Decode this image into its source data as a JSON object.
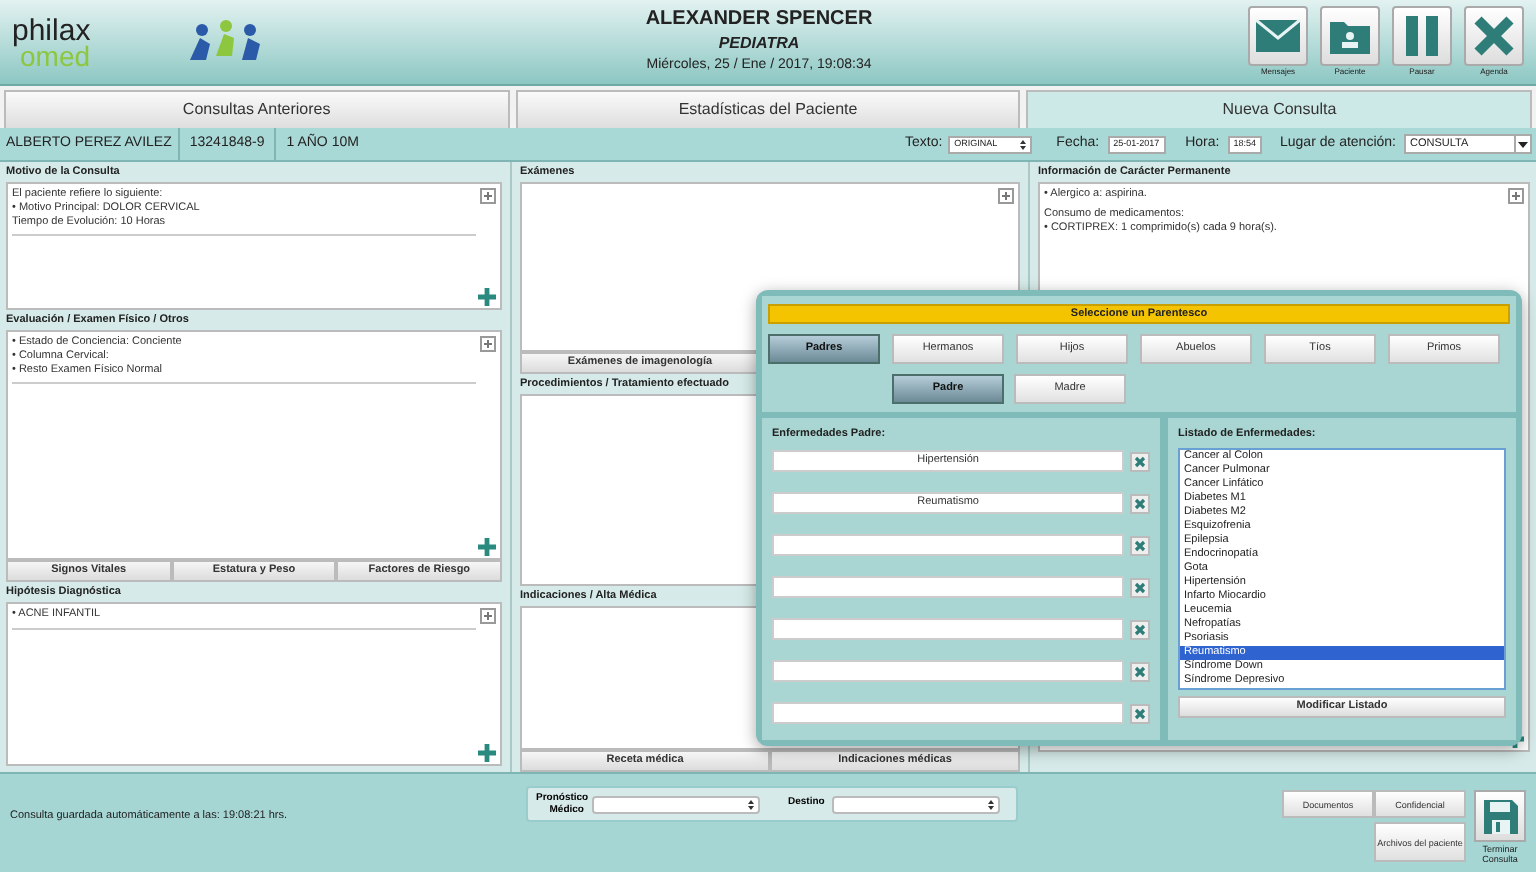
{
  "header": {
    "logo": {
      "word_1": "philax",
      "word_2": "omed"
    },
    "patient_name": "ALEXANDER SPENCER",
    "specialty": "PEDIATRA",
    "datetime": "Miércoles, 25 / Ene / 2017, 19:08:34",
    "actions": [
      {
        "kind": "mail",
        "label": "Mensajes"
      },
      {
        "kind": "folder",
        "label": "Paciente"
      },
      {
        "kind": "pause",
        "label": "Pausar"
      },
      {
        "kind": "close",
        "label": "Agenda"
      }
    ]
  },
  "tabs": [
    {
      "label": "Consultas Anteriores",
      "selected": false
    },
    {
      "label": "Estadísticas del Paciente",
      "selected": false
    },
    {
      "label": "Nueva Consulta",
      "selected": true
    }
  ],
  "patient_bar": {
    "name": "ALBERTO PEREZ AVILEZ",
    "id": "13241848-9",
    "age": "1 AÑO 10M",
    "texto_label": "Texto:",
    "texto_value": "ORIGINAL",
    "fecha_label": "Fecha:",
    "fecha_value": "25-01-2017",
    "hora_label": "Hora:",
    "hora_value": "18:54",
    "lugar_label": "Lugar de atención:",
    "lugar_value": "CONSULTA"
  },
  "left_column": [
    {
      "title": "Motivo de la Consulta",
      "lines": [
        "El paciente refiere lo siguiente:",
        "• Motivo Principal: DOLOR CERVICAL",
        "Tiempo de Evolución: 10 Horas"
      ]
    },
    {
      "title": "Evaluación / Examen Físico / Otros",
      "lines": [
        "• Estado de Conciencia: Conciente",
        "• Columna Cervical:",
        "• Resto Examen Físico Normal"
      ],
      "buttons": [
        "Signos Vitales",
        "Estatura y Peso",
        "Factores de Riesgo"
      ]
    },
    {
      "title": "Hipótesis Diagnóstica",
      "lines": [
        "• ACNE INFANTIL"
      ]
    }
  ],
  "middle_column": [
    {
      "title": "Exámenes",
      "buttons": [
        "Exámenes de imagenología"
      ]
    },
    {
      "title": "Procedimientos / Tratamiento efectuado"
    },
    {
      "title": "Indicaciones / Alta Médica",
      "buttons": [
        "Receta médica",
        "Indicaciones médicas"
      ]
    }
  ],
  "right_column": {
    "title": "Información de Carácter Permanente",
    "lines": [
      "• Alergico a: aspirina.",
      "Consumo de medicamentos:",
      "• CORTIPREX: 1 comprimido(s) cada 9 hora(s)."
    ]
  },
  "modal": {
    "banner": "Seleccione un Parentesco",
    "relatives": [
      {
        "label": "Padres",
        "selected": true
      },
      {
        "label": "Hermanos",
        "selected": false
      },
      {
        "label": "Hijos",
        "selected": false
      },
      {
        "label": "Abuelos",
        "selected": false
      },
      {
        "label": "Tíos",
        "selected": false
      },
      {
        "label": "Primos",
        "selected": false
      }
    ],
    "members": [
      {
        "label": "Padre",
        "selected": true
      },
      {
        "label": "Madre",
        "selected": false
      }
    ],
    "diseases_title": "Enfermedades Padre:",
    "diseases": [
      {
        "kind": "filled",
        "value": "Hipertensión"
      },
      {
        "kind": "filled",
        "value": "Reumatismo"
      },
      {
        "kind": "empty"
      },
      {
        "kind": "empty"
      },
      {
        "kind": "empty"
      },
      {
        "kind": "empty"
      },
      {
        "kind": "empty"
      }
    ],
    "list_title": "Listado de Enfermedades:",
    "list": [
      {
        "label": "Cancer al Colon",
        "selected": false
      },
      {
        "label": "Cancer Pulmonar",
        "selected": false
      },
      {
        "label": "Cancer Linfático",
        "selected": false
      },
      {
        "label": "Diabetes M1",
        "selected": false
      },
      {
        "label": "Diabetes M2",
        "selected": false
      },
      {
        "label": "Esquizofrenia",
        "selected": false
      },
      {
        "label": "Epilepsia",
        "selected": false
      },
      {
        "label": "Endocrinopatía",
        "selected": false
      },
      {
        "label": "Gota",
        "selected": false
      },
      {
        "label": "Hipertensión",
        "selected": false
      },
      {
        "label": "Infarto Miocardio",
        "selected": false
      },
      {
        "label": "Leucemia",
        "selected": false
      },
      {
        "label": "Nefropatías",
        "selected": false
      },
      {
        "label": "Psoriasis",
        "selected": false
      },
      {
        "label": "Reumatismo",
        "selected": true
      },
      {
        "label": "Síndrome Down",
        "selected": false
      },
      {
        "label": "Síndrome Depresivo",
        "selected": false
      }
    ],
    "list_button": "Modificar Listado"
  },
  "footer": {
    "status": "Consulta guardada automáticamente a las: 19:08:21 hrs.",
    "prognosis_label": "Pronóstico Médico",
    "destination_label": "Destino",
    "buttons": [
      "Documentos",
      "Confidencial",
      "Archivos del paciente"
    ],
    "finish_label": "Terminar Consulta"
  }
}
